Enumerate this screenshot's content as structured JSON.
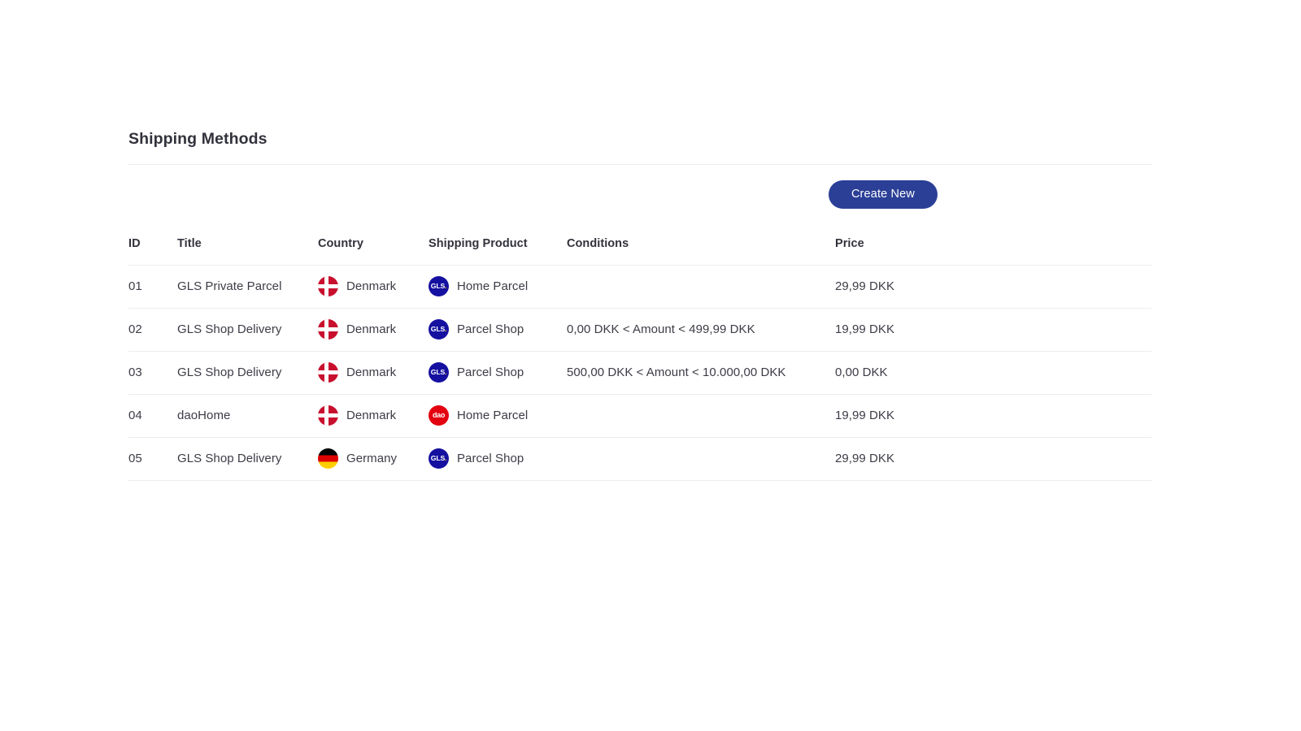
{
  "page": {
    "title": "Shipping Methods"
  },
  "toolbar": {
    "create_label": "Create New",
    "accent_color": "#2b3f96"
  },
  "table": {
    "columns": [
      {
        "key": "id",
        "label": "ID"
      },
      {
        "key": "title",
        "label": "Title"
      },
      {
        "key": "country",
        "label": "Country"
      },
      {
        "key": "product",
        "label": "Shipping Product"
      },
      {
        "key": "conditions",
        "label": "Conditions"
      },
      {
        "key": "price",
        "label": "Price"
      }
    ],
    "rows": [
      {
        "id": "01",
        "title": "GLS Private Parcel",
        "country": "Denmark",
        "country_flag_icon": "flag-denmark-icon",
        "product": "Home Parcel",
        "product_logo_icon": "gls-logo-icon",
        "product_logo_text": "GLS",
        "product_logo_dot": ".",
        "conditions": "",
        "price": "29,99 DKK"
      },
      {
        "id": "02",
        "title": "GLS Shop Delivery",
        "country": "Denmark",
        "country_flag_icon": "flag-denmark-icon",
        "product": "Parcel Shop",
        "product_logo_icon": "gls-logo-icon",
        "product_logo_text": "GLS",
        "product_logo_dot": ".",
        "conditions": "0,00 DKK < Amount < 499,99 DKK",
        "price": "19,99 DKK"
      },
      {
        "id": "03",
        "title": "GLS Shop Delivery",
        "country": "Denmark",
        "country_flag_icon": "flag-denmark-icon",
        "product": "Parcel Shop",
        "product_logo_icon": "gls-logo-icon",
        "product_logo_text": "GLS",
        "product_logo_dot": ".",
        "conditions": "500,00 DKK < Amount < 10.000,00 DKK",
        "price": "0,00 DKK"
      },
      {
        "id": "04",
        "title": "daoHome",
        "country": "Denmark",
        "country_flag_icon": "flag-denmark-icon",
        "product": "Home Parcel",
        "product_logo_icon": "dao-logo-icon",
        "product_logo_text": "dao",
        "product_logo_dot": "",
        "conditions": "",
        "price": "19,99 DKK"
      },
      {
        "id": "05",
        "title": "GLS Shop Delivery",
        "country": "Germany",
        "country_flag_icon": "flag-germany-icon",
        "product": "Parcel Shop",
        "product_logo_icon": "gls-logo-icon",
        "product_logo_text": "GLS",
        "product_logo_dot": ".",
        "conditions": "",
        "price": "29,99 DKK"
      }
    ]
  }
}
